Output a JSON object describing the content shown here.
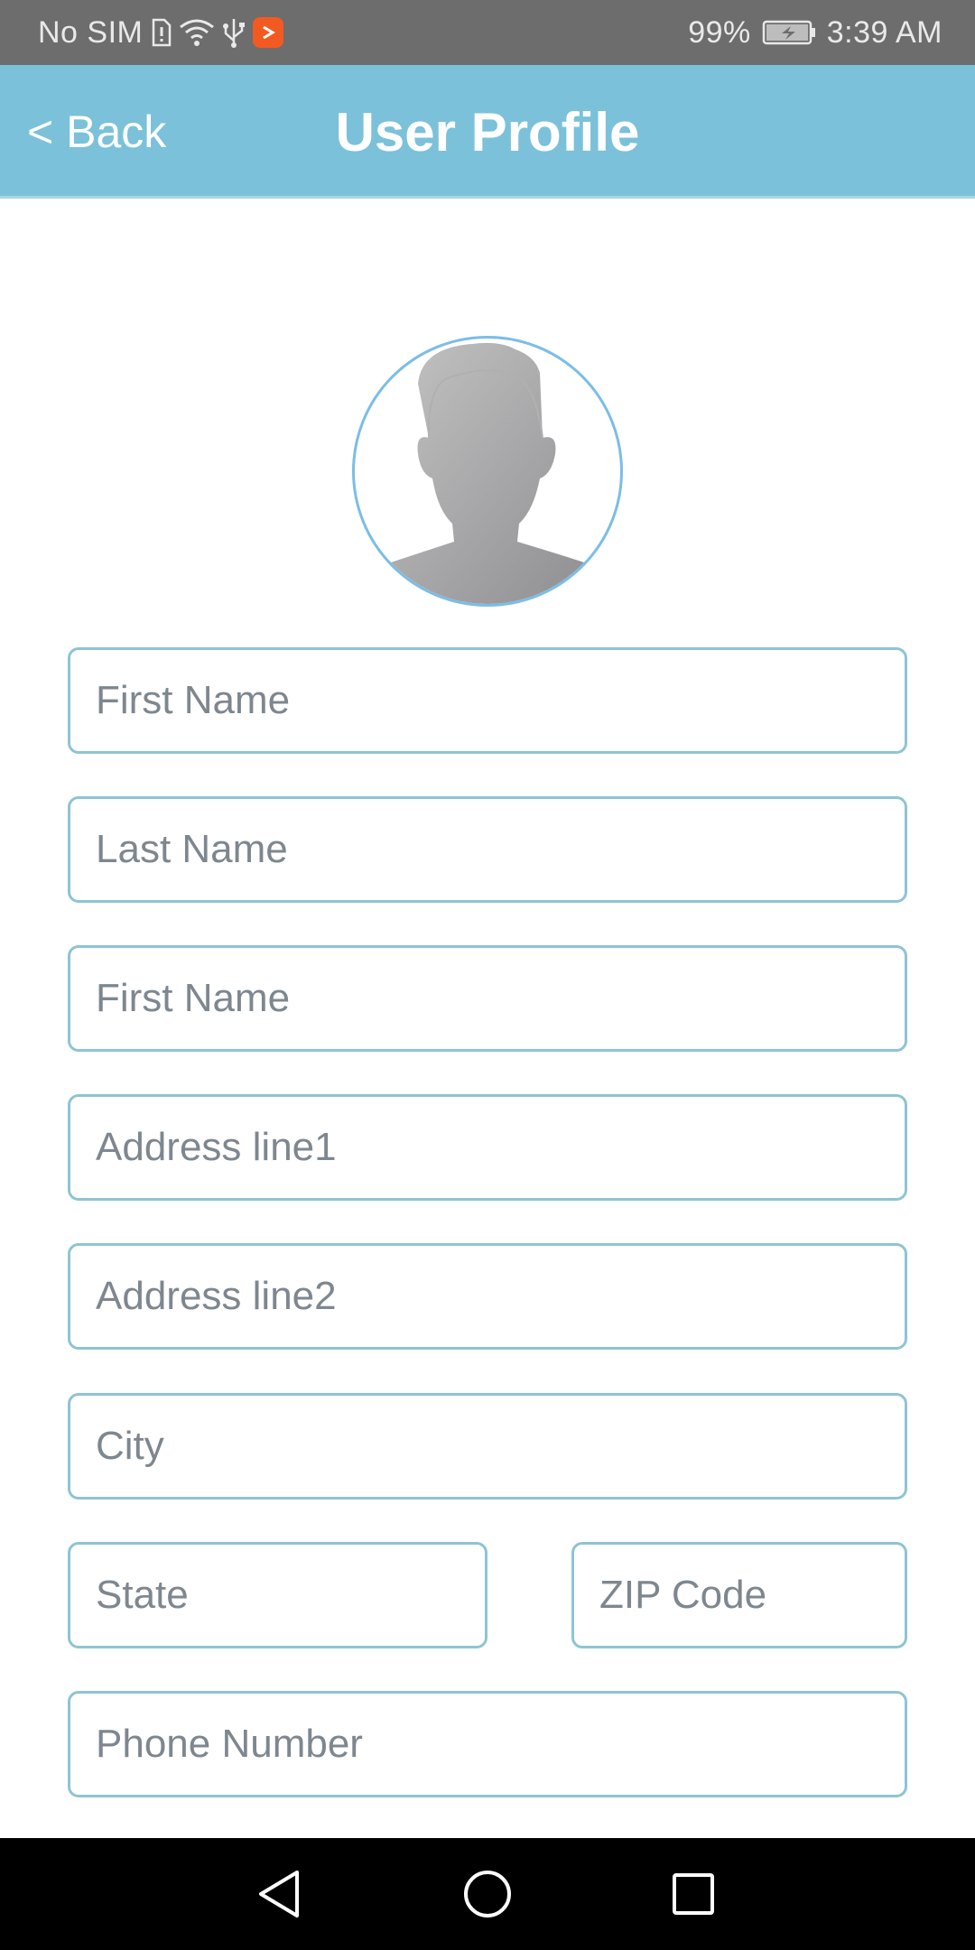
{
  "status_bar": {
    "carrier": "No SIM",
    "battery": "99%",
    "time": "3:39 AM",
    "icons": [
      "sim-alert-icon",
      "wifi-icon",
      "usb-icon",
      "app-notification-icon",
      "battery-charging-icon"
    ]
  },
  "header": {
    "back_label": "< Back",
    "title": "User Profile",
    "background": "#7bc1da"
  },
  "avatar": {
    "icon": "default-avatar-icon",
    "border_color": "#7cbde6"
  },
  "form": {
    "fields": [
      {
        "placeholder": "First Name",
        "value": ""
      },
      {
        "placeholder": "Last Name",
        "value": ""
      },
      {
        "placeholder": "First Name",
        "value": ""
      },
      {
        "placeholder": "Address line1",
        "value": ""
      },
      {
        "placeholder": "Address line2",
        "value": ""
      },
      {
        "placeholder": "City",
        "value": ""
      },
      {
        "placeholder": "State",
        "value": ""
      },
      {
        "placeholder": "ZIP Code",
        "value": ""
      },
      {
        "placeholder": "Phone Number",
        "value": ""
      }
    ],
    "border_color": "#8ec4d3"
  },
  "nav_bar": {
    "icons": [
      "back-triangle-icon",
      "home-circle-icon",
      "recents-square-icon"
    ]
  }
}
